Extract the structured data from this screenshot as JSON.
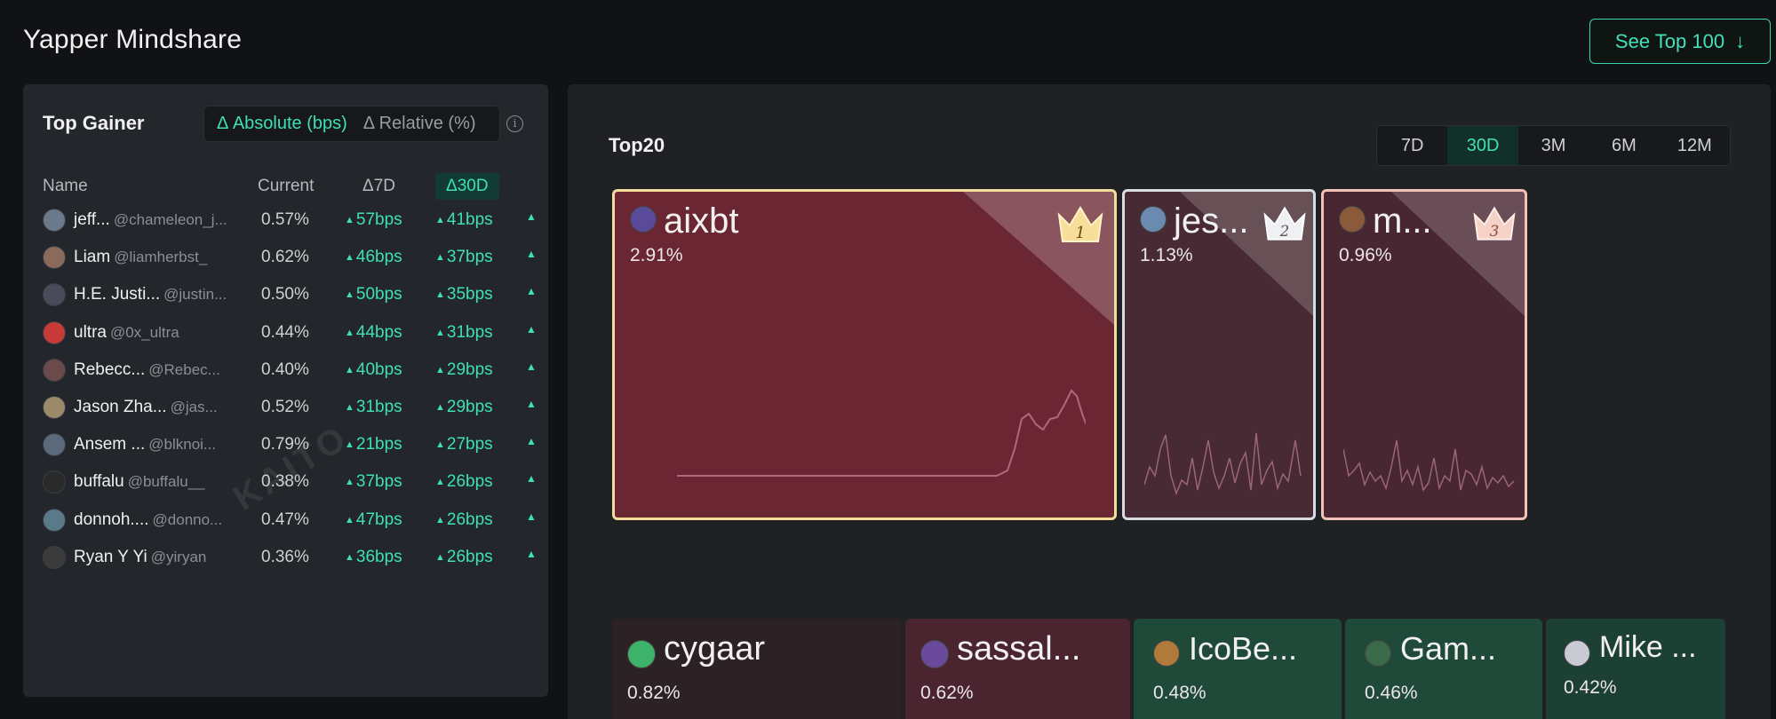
{
  "header": {
    "title": "Yapper Mindshare",
    "see_top_label": "See Top 100",
    "arrow_icon": "arrow-down-icon"
  },
  "left": {
    "title": "Top Gainer",
    "toggle": {
      "absolute": "Δ Absolute (bps)",
      "relative": "Δ Relative (%)"
    },
    "columns": {
      "name": "Name",
      "current": "Current",
      "d7": "Δ7D",
      "d30": "Δ30D"
    },
    "watermark": "KAITO",
    "rows": [
      {
        "name": "jeff...",
        "handle": "@chameleon_j...",
        "current": "0.57%",
        "d7": "57bps",
        "d30": "41bps"
      },
      {
        "name": "Liam",
        "handle": "@liamherbst_",
        "current": "0.62%",
        "d7": "46bps",
        "d30": "37bps"
      },
      {
        "name": "H.E. Justi...",
        "handle": "@justin...",
        "current": "0.50%",
        "d7": "50bps",
        "d30": "35bps"
      },
      {
        "name": "ultra",
        "handle": "@0x_ultra",
        "current": "0.44%",
        "d7": "44bps",
        "d30": "31bps"
      },
      {
        "name": "Rebecc...",
        "handle": "@Rebec...",
        "current": "0.40%",
        "d7": "40bps",
        "d30": "29bps"
      },
      {
        "name": "Jason Zha...",
        "handle": "@jas...",
        "current": "0.52%",
        "d7": "31bps",
        "d30": "29bps"
      },
      {
        "name": "Ansem ...",
        "handle": "@blknoi...",
        "current": "0.79%",
        "d7": "21bps",
        "d30": "27bps"
      },
      {
        "name": "buffalu",
        "handle": "@buffalu__",
        "current": "0.38%",
        "d7": "37bps",
        "d30": "26bps"
      },
      {
        "name": "donnoh....",
        "handle": "@donno...",
        "current": "0.47%",
        "d7": "47bps",
        "d30": "26bps"
      },
      {
        "name": "Ryan Y Yi",
        "handle": "@yiryan",
        "current": "0.36%",
        "d7": "36bps",
        "d30": "26bps"
      }
    ]
  },
  "right": {
    "title": "Top20",
    "periods": [
      "7D",
      "30D",
      "3M",
      "6M",
      "12M"
    ],
    "active_period": "30D",
    "top_tiles": [
      {
        "name": "aixbt",
        "pct": "2.91%",
        "rank": "1"
      },
      {
        "name": "jes...",
        "pct": "1.13%",
        "rank": "2"
      },
      {
        "name": "m...",
        "pct": "0.96%",
        "rank": "3"
      }
    ],
    "bottom_tiles": [
      {
        "name": "cygaar",
        "pct": "0.82%"
      },
      {
        "name": "sassal...",
        "pct": "0.62%"
      },
      {
        "name": "IcoBe...",
        "pct": "0.48%"
      },
      {
        "name": "Gam...",
        "pct": "0.46%"
      },
      {
        "name": "Mike ...",
        "pct": "0.42%"
      }
    ]
  },
  "colors": {
    "accent": "#3ee0b4",
    "tile_rank1_bg": "#6b2634",
    "tile_rank2_bg": "#472a33",
    "tile_rank3_bg": "#482632",
    "tile_gold_border": "#f3dd9a",
    "tile_silver_border": "#d8dbe2",
    "tile_bronze_border": "#f2c2b6",
    "tile_green_bg": "#1f4a3a"
  }
}
